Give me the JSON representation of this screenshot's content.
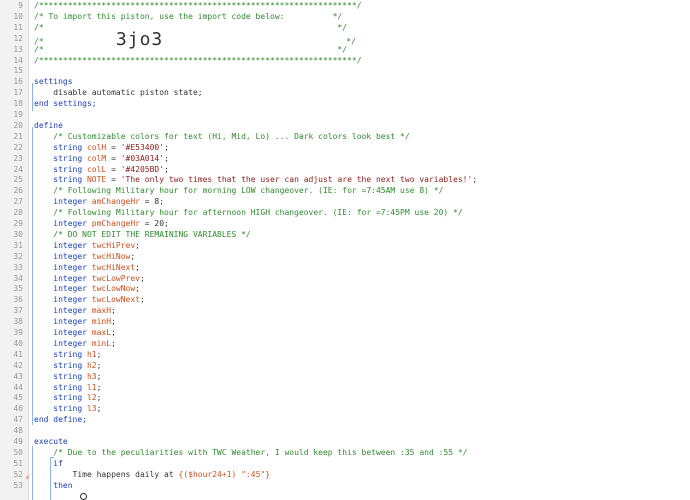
{
  "editor": {
    "lines": [
      {
        "n": "9",
        "parts": [
          {
            "c": "cm",
            "t": "/******************************************************************/"
          }
        ]
      },
      {
        "n": "10",
        "parts": [
          {
            "c": "cm",
            "t": "/* To import this piston, use the import code below:          */"
          }
        ]
      },
      {
        "n": "11",
        "parts": [
          {
            "c": "cm",
            "t": "/*                                                             */"
          }
        ]
      },
      {
        "n": "12",
        "parts": [
          {
            "c": "cm",
            "t": "/*               "
          },
          {
            "c": "big",
            "t": "3jo3"
          },
          {
            "c": "cm",
            "t": "                                      */"
          }
        ]
      },
      {
        "n": "13",
        "parts": [
          {
            "c": "cm",
            "t": "/*                                                             */"
          }
        ]
      },
      {
        "n": "14",
        "parts": [
          {
            "c": "cm",
            "t": "/******************************************************************/"
          }
        ]
      },
      {
        "n": "15",
        "parts": []
      },
      {
        "n": "16",
        "parts": [
          {
            "c": "kw",
            "t": "settings"
          }
        ]
      },
      {
        "n": "17",
        "parts": [
          {
            "c": "pl",
            "t": "    disable automatic piston state;"
          }
        ]
      },
      {
        "n": "18",
        "parts": [
          {
            "c": "kw",
            "t": "end settings;"
          }
        ]
      },
      {
        "n": "19",
        "parts": []
      },
      {
        "n": "20",
        "parts": [
          {
            "c": "kw",
            "t": "define"
          }
        ]
      },
      {
        "n": "21",
        "parts": [
          {
            "c": "cm",
            "t": "    /* Customizable colors for text (Hi, Mid, Lo) ... Dark colors look best */"
          }
        ]
      },
      {
        "n": "22",
        "parts": [
          {
            "c": "ty",
            "t": "    string "
          },
          {
            "c": "var",
            "t": "colH"
          },
          {
            "c": "pl",
            "t": " = "
          },
          {
            "c": "str",
            "t": "'#E53400'"
          },
          {
            "c": "pl",
            "t": ";"
          }
        ]
      },
      {
        "n": "23",
        "parts": [
          {
            "c": "ty",
            "t": "    string "
          },
          {
            "c": "var",
            "t": "colM"
          },
          {
            "c": "pl",
            "t": " = "
          },
          {
            "c": "str",
            "t": "'#03A014'"
          },
          {
            "c": "pl",
            "t": ";"
          }
        ]
      },
      {
        "n": "24",
        "parts": [
          {
            "c": "ty",
            "t": "    string "
          },
          {
            "c": "var",
            "t": "colL"
          },
          {
            "c": "pl",
            "t": " = "
          },
          {
            "c": "str",
            "t": "'#4205BD'"
          },
          {
            "c": "pl",
            "t": ";"
          }
        ]
      },
      {
        "n": "25",
        "parts": [
          {
            "c": "ty",
            "t": "    string "
          },
          {
            "c": "var",
            "t": "NOTE"
          },
          {
            "c": "pl",
            "t": " = "
          },
          {
            "c": "str",
            "t": "'The only two times that the user can adjust are the next two variables!'"
          },
          {
            "c": "pl",
            "t": ";"
          }
        ]
      },
      {
        "n": "26",
        "parts": [
          {
            "c": "cm",
            "t": "    /* Following Military hour for morning LOW changeover. (IE: for =7:45AM use 8) */"
          }
        ]
      },
      {
        "n": "27",
        "parts": [
          {
            "c": "ty",
            "t": "    integer "
          },
          {
            "c": "var",
            "t": "amChangeHr"
          },
          {
            "c": "pl",
            "t": " = 8;"
          }
        ]
      },
      {
        "n": "28",
        "parts": [
          {
            "c": "cm",
            "t": "    /* Following Military hour for afternoon HIGH changeover. (IE: for =7:45PM use 20) */"
          }
        ]
      },
      {
        "n": "29",
        "parts": [
          {
            "c": "ty",
            "t": "    integer "
          },
          {
            "c": "var",
            "t": "pmChangeHr"
          },
          {
            "c": "pl",
            "t": " = 20;"
          }
        ]
      },
      {
        "n": "30",
        "parts": [
          {
            "c": "cm",
            "t": "    /* DO NOT EDIT THE REMAINING VARIABLES */"
          }
        ]
      },
      {
        "n": "31",
        "parts": [
          {
            "c": "ty",
            "t": "    integer "
          },
          {
            "c": "var",
            "t": "twcHiPrev"
          },
          {
            "c": "pl",
            "t": ";"
          }
        ]
      },
      {
        "n": "32",
        "parts": [
          {
            "c": "ty",
            "t": "    integer "
          },
          {
            "c": "var",
            "t": "twcHiNow"
          },
          {
            "c": "pl",
            "t": ";"
          }
        ]
      },
      {
        "n": "33",
        "parts": [
          {
            "c": "ty",
            "t": "    integer "
          },
          {
            "c": "var",
            "t": "twcHiNext"
          },
          {
            "c": "pl",
            "t": ";"
          }
        ]
      },
      {
        "n": "34",
        "parts": [
          {
            "c": "ty",
            "t": "    integer "
          },
          {
            "c": "var",
            "t": "twcLowPrev"
          },
          {
            "c": "pl",
            "t": ";"
          }
        ]
      },
      {
        "n": "35",
        "parts": [
          {
            "c": "ty",
            "t": "    integer "
          },
          {
            "c": "var",
            "t": "twcLowNow"
          },
          {
            "c": "pl",
            "t": ";"
          }
        ]
      },
      {
        "n": "36",
        "parts": [
          {
            "c": "ty",
            "t": "    integer "
          },
          {
            "c": "var",
            "t": "twcLowNext"
          },
          {
            "c": "pl",
            "t": ";"
          }
        ]
      },
      {
        "n": "37",
        "parts": [
          {
            "c": "ty",
            "t": "    integer "
          },
          {
            "c": "var",
            "t": "maxH"
          },
          {
            "c": "pl",
            "t": ";"
          }
        ]
      },
      {
        "n": "38",
        "parts": [
          {
            "c": "ty",
            "t": "    integer "
          },
          {
            "c": "var",
            "t": "minH"
          },
          {
            "c": "pl",
            "t": ";"
          }
        ]
      },
      {
        "n": "39",
        "parts": [
          {
            "c": "ty",
            "t": "    integer "
          },
          {
            "c": "var",
            "t": "maxL"
          },
          {
            "c": "pl",
            "t": ";"
          }
        ]
      },
      {
        "n": "40",
        "parts": [
          {
            "c": "ty",
            "t": "    integer "
          },
          {
            "c": "var",
            "t": "minL"
          },
          {
            "c": "pl",
            "t": ";"
          }
        ]
      },
      {
        "n": "41",
        "parts": [
          {
            "c": "ty",
            "t": "    string "
          },
          {
            "c": "var",
            "t": "h1"
          },
          {
            "c": "pl",
            "t": ";"
          }
        ]
      },
      {
        "n": "42",
        "parts": [
          {
            "c": "ty",
            "t": "    string "
          },
          {
            "c": "var",
            "t": "h2"
          },
          {
            "c": "pl",
            "t": ";"
          }
        ]
      },
      {
        "n": "43",
        "parts": [
          {
            "c": "ty",
            "t": "    string "
          },
          {
            "c": "var",
            "t": "h3"
          },
          {
            "c": "pl",
            "t": ";"
          }
        ]
      },
      {
        "n": "44",
        "parts": [
          {
            "c": "ty",
            "t": "    string "
          },
          {
            "c": "var",
            "t": "l1"
          },
          {
            "c": "pl",
            "t": ";"
          }
        ]
      },
      {
        "n": "45",
        "parts": [
          {
            "c": "ty",
            "t": "    string "
          },
          {
            "c": "var",
            "t": "l2"
          },
          {
            "c": "pl",
            "t": ";"
          }
        ]
      },
      {
        "n": "46",
        "parts": [
          {
            "c": "ty",
            "t": "    string "
          },
          {
            "c": "var",
            "t": "l3"
          },
          {
            "c": "pl",
            "t": ";"
          }
        ]
      },
      {
        "n": "47",
        "parts": [
          {
            "c": "kw",
            "t": "end define;"
          }
        ]
      },
      {
        "n": "48",
        "parts": []
      },
      {
        "n": "49",
        "parts": [
          {
            "c": "kw",
            "t": "execute"
          }
        ]
      },
      {
        "n": "50",
        "parts": [
          {
            "c": "cm",
            "t": "    /* Due to the peculiarities with TWC Weather, I would keep this between :35 and :55 */"
          }
        ]
      },
      {
        "n": "51",
        "parts": [
          {
            "c": "kw",
            "t": "    if"
          }
        ]
      },
      {
        "n": "52",
        "parts": [
          {
            "c": "pl",
            "t": "        Time happens daily at "
          },
          {
            "c": "ex",
            "t": "{($hour24+1) \":45\"}"
          }
        ]
      },
      {
        "n": "53",
        "parts": [
          {
            "c": "kw",
            "t": "    then"
          }
        ]
      }
    ]
  },
  "icons": {
    "trigger": "lightning-bolt-icon",
    "cursor": "mouse-cursor-icon"
  },
  "colors": {
    "comment": "#2e8b2e",
    "keyword": "#1a3fb3",
    "variable": "#c8501e",
    "string": "#8b1a1a",
    "gutter": "#f2f2f2",
    "guide": "#8ab4e8"
  }
}
